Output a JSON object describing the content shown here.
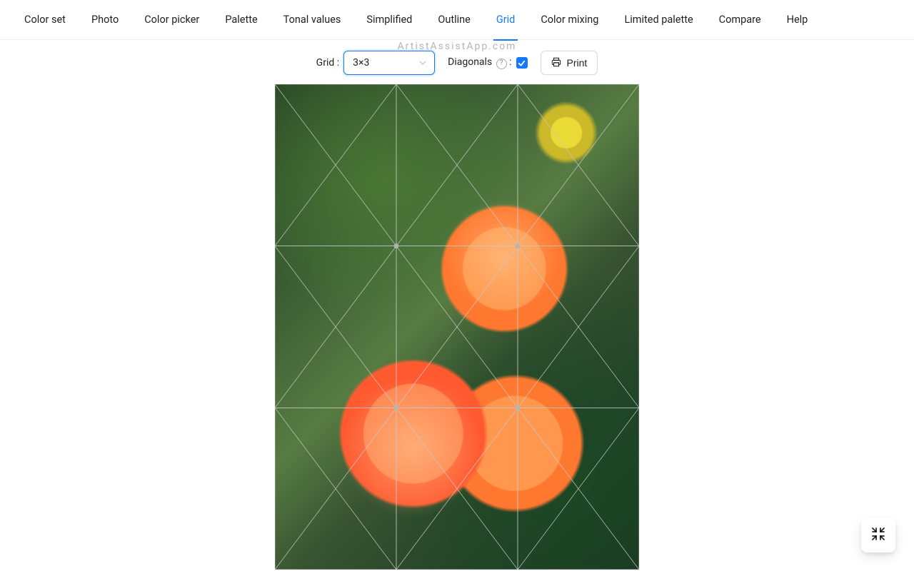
{
  "watermark": "ArtistAssistApp.com",
  "tabs": [
    {
      "label": "Color set",
      "active": false
    },
    {
      "label": "Photo",
      "active": false
    },
    {
      "label": "Color picker",
      "active": false
    },
    {
      "label": "Palette",
      "active": false
    },
    {
      "label": "Tonal values",
      "active": false
    },
    {
      "label": "Simplified",
      "active": false
    },
    {
      "label": "Outline",
      "active": false
    },
    {
      "label": "Grid",
      "active": true
    },
    {
      "label": "Color mixing",
      "active": false
    },
    {
      "label": "Limited palette",
      "active": false
    },
    {
      "label": "Compare",
      "active": false
    },
    {
      "label": "Help",
      "active": false
    }
  ],
  "toolbar": {
    "grid_label": "Grid",
    "grid_value": "3×3",
    "diagonals_label": "Diagonals",
    "diagonals_checked": true,
    "print_label": "Print"
  },
  "grid": {
    "cols": 3,
    "rows": 3,
    "diagonals": true
  },
  "colors": {
    "accent": "#1677ff"
  }
}
